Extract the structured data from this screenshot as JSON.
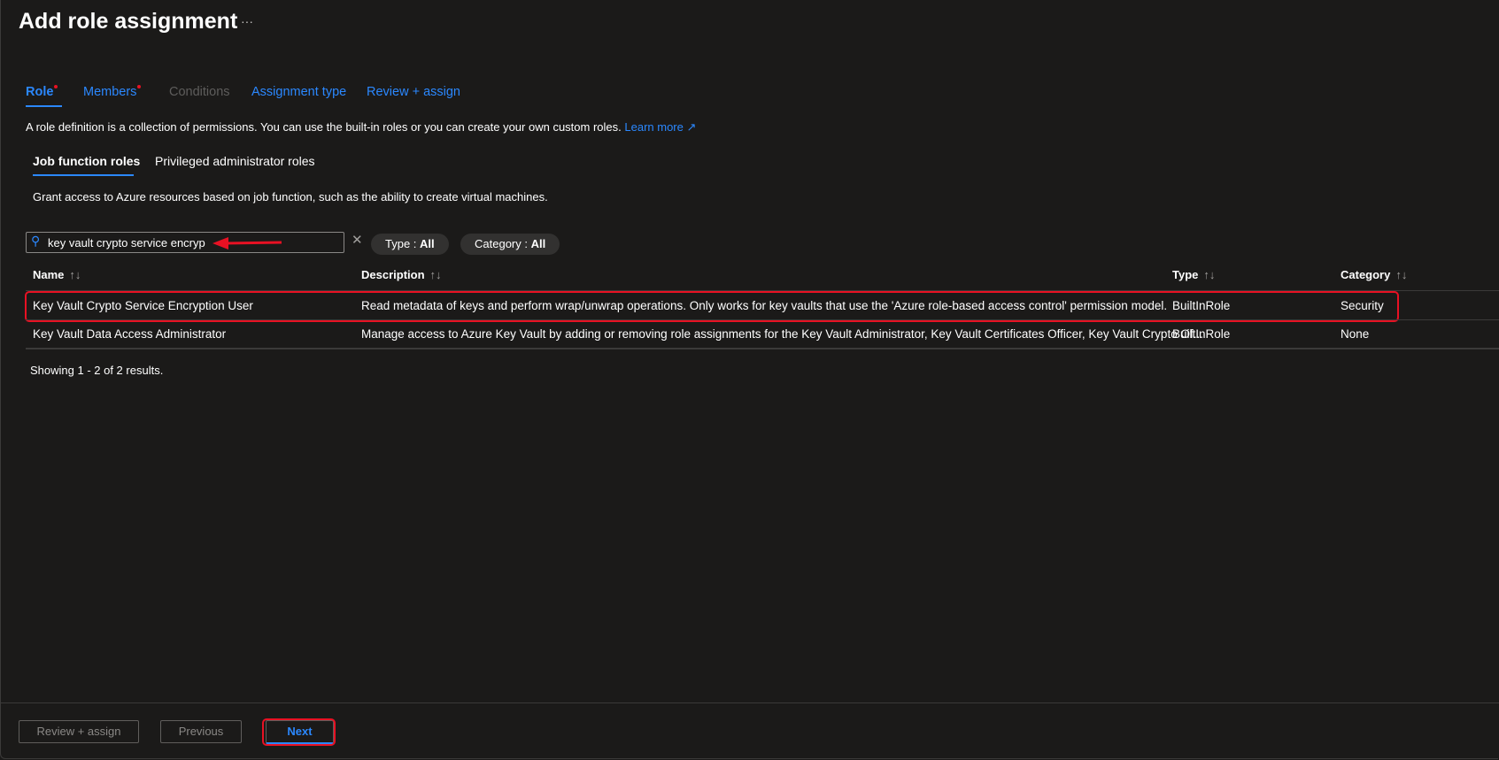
{
  "header": {
    "title": "Add role assignment",
    "more": "···"
  },
  "tabs": [
    {
      "label": "Role",
      "required": true
    },
    {
      "label": "Members",
      "required": true
    },
    {
      "label": "Conditions"
    },
    {
      "label": "Assignment type"
    },
    {
      "label": "Review + assign"
    }
  ],
  "intro": {
    "text": "A role definition is a collection of permissions. You can use the built-in roles or you can create your own custom roles.",
    "link": "Learn more"
  },
  "subtabs": [
    {
      "label": "Job function roles"
    },
    {
      "label": "Privileged administrator roles"
    }
  ],
  "subtab_desc": "Grant access to Azure resources based on job function, such as the ability to create virtual machines.",
  "search": {
    "value": "key vault crypto service encryp"
  },
  "filters": [
    {
      "label": "Type : ",
      "value": "All"
    },
    {
      "label": "Category : ",
      "value": "All"
    }
  ],
  "table": {
    "columns": [
      "Name",
      "Description",
      "Type",
      "Category"
    ],
    "rows": [
      {
        "name": "Key Vault Crypto Service Encryption User",
        "description": "Read metadata of keys and perform wrap/unwrap operations. Only works for key vaults that use the 'Azure role-based access control' permission model.",
        "type": "BuiltInRole",
        "category": "Security"
      },
      {
        "name": "Key Vault Data Access Administrator",
        "description": "Manage access to Azure Key Vault by adding or removing role assignments for the Key Vault Administrator, Key Vault Certificates Officer, Key Vault Crypto Of...",
        "type": "BuiltInRole",
        "category": "None"
      }
    ]
  },
  "results": "Showing 1 - 2 of 2 results.",
  "footer": {
    "review": "Review + assign",
    "previous": "Previous",
    "next": "Next"
  },
  "colors": {
    "accent": "#2b88ff",
    "annotation": "#e81123"
  }
}
